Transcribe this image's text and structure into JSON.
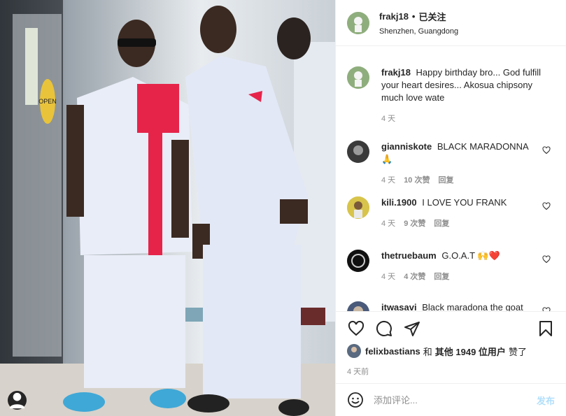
{
  "colors": {
    "accent": "#0095f6",
    "post_disabled": "#b2dffc",
    "muted": "#8e8e8e",
    "text": "#262626"
  },
  "post": {
    "author": "frakj18",
    "separator": "•",
    "follow_label": "已关注",
    "location": "Shenzhen, Guangdong",
    "photo_sign": "OPEN",
    "caption": {
      "username": "frakj18",
      "text": "Happy birthday bro... God fulfill your heart desires... Akosua chipsony much love wate",
      "time": "4 天"
    },
    "comments": [
      {
        "username": "gianniskote",
        "text": "BLACK MARADONNA 🙏",
        "time": "4 天",
        "likes": "10 次赞",
        "reply": "回复"
      },
      {
        "username": "kili.1900",
        "text": "I LOVE YOU FRANK",
        "time": "4 天",
        "likes": "9 次赞",
        "reply": "回复"
      },
      {
        "username": "thetruebaum",
        "text": "G.O.A.T 🙌❤️",
        "time": "4 天",
        "likes": "4 次赞",
        "reply": "回复"
      },
      {
        "username": "itwasavi",
        "text": "Black maradona the goat",
        "time": "",
        "likes": "",
        "reply": ""
      }
    ],
    "liked_by": {
      "user": "felixbastians",
      "and": "和",
      "others": "其他 1949 位用户",
      "suffix": "赞了"
    },
    "posted_time": "4 天前",
    "add_comment_placeholder": "添加评论...",
    "post_button": "发布"
  },
  "icons": {
    "like": "heart-icon",
    "comment": "comment-icon",
    "share": "share-icon",
    "save": "bookmark-icon",
    "emoji": "emoji-icon",
    "tag": "user-tag-icon"
  }
}
